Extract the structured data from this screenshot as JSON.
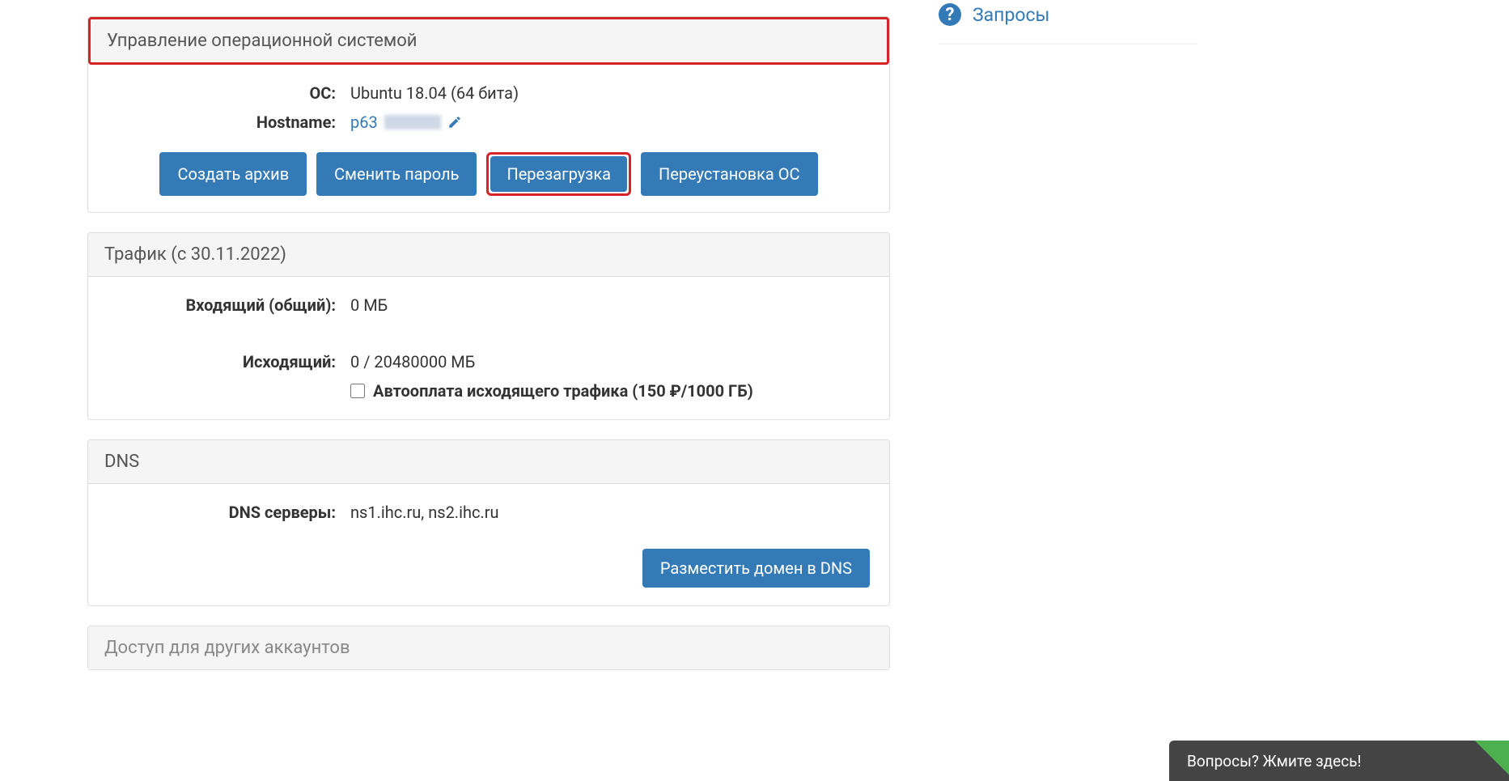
{
  "os_panel": {
    "title": "Управление операционной системой",
    "os_label": "ОС:",
    "os_value": "Ubuntu 18.04 (64 бита)",
    "hostname_label": "Hostname:",
    "hostname_prefix": "p63",
    "buttons": {
      "archive": "Создать архив",
      "change_password": "Сменить пароль",
      "reboot": "Перезагрузка",
      "reinstall": "Переустановка ОС"
    }
  },
  "traffic_panel": {
    "title": "Трафик (с 30.11.2022)",
    "incoming_label": "Входящий (общий):",
    "incoming_value": "0 МБ",
    "outgoing_label": "Исходящий:",
    "outgoing_value": "0 / 20480000 МБ",
    "autopay_label": "Автооплата исходящего трафика (150 ₽/1000 ГБ)"
  },
  "dns_panel": {
    "title": "DNS",
    "servers_label": "DNS серверы:",
    "servers_value": "ns1.ihc.ru, ns2.ihc.ru",
    "place_domain_btn": "Разместить домен в DNS"
  },
  "access_panel": {
    "title": "Доступ для других аккаунтов"
  },
  "sidebar": {
    "requests": "Запросы"
  },
  "chat": {
    "text": "Вопросы? Жмите здесь!"
  }
}
